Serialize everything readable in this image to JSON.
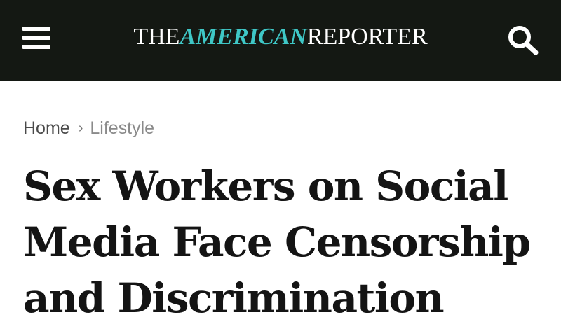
{
  "header": {
    "logo": {
      "part1": "THE",
      "part2": "AMERICAN",
      "part3": "REPORTER"
    },
    "menu_icon": "hamburger-menu-icon",
    "search_icon": "search-icon",
    "colors": {
      "background": "#141813",
      "accent": "#3fc7c6"
    }
  },
  "breadcrumb": {
    "home": "Home",
    "separator": "›",
    "current": "Lifestyle"
  },
  "article": {
    "title": "Sex Workers on Social Media Face Censorship and Discrimination"
  }
}
